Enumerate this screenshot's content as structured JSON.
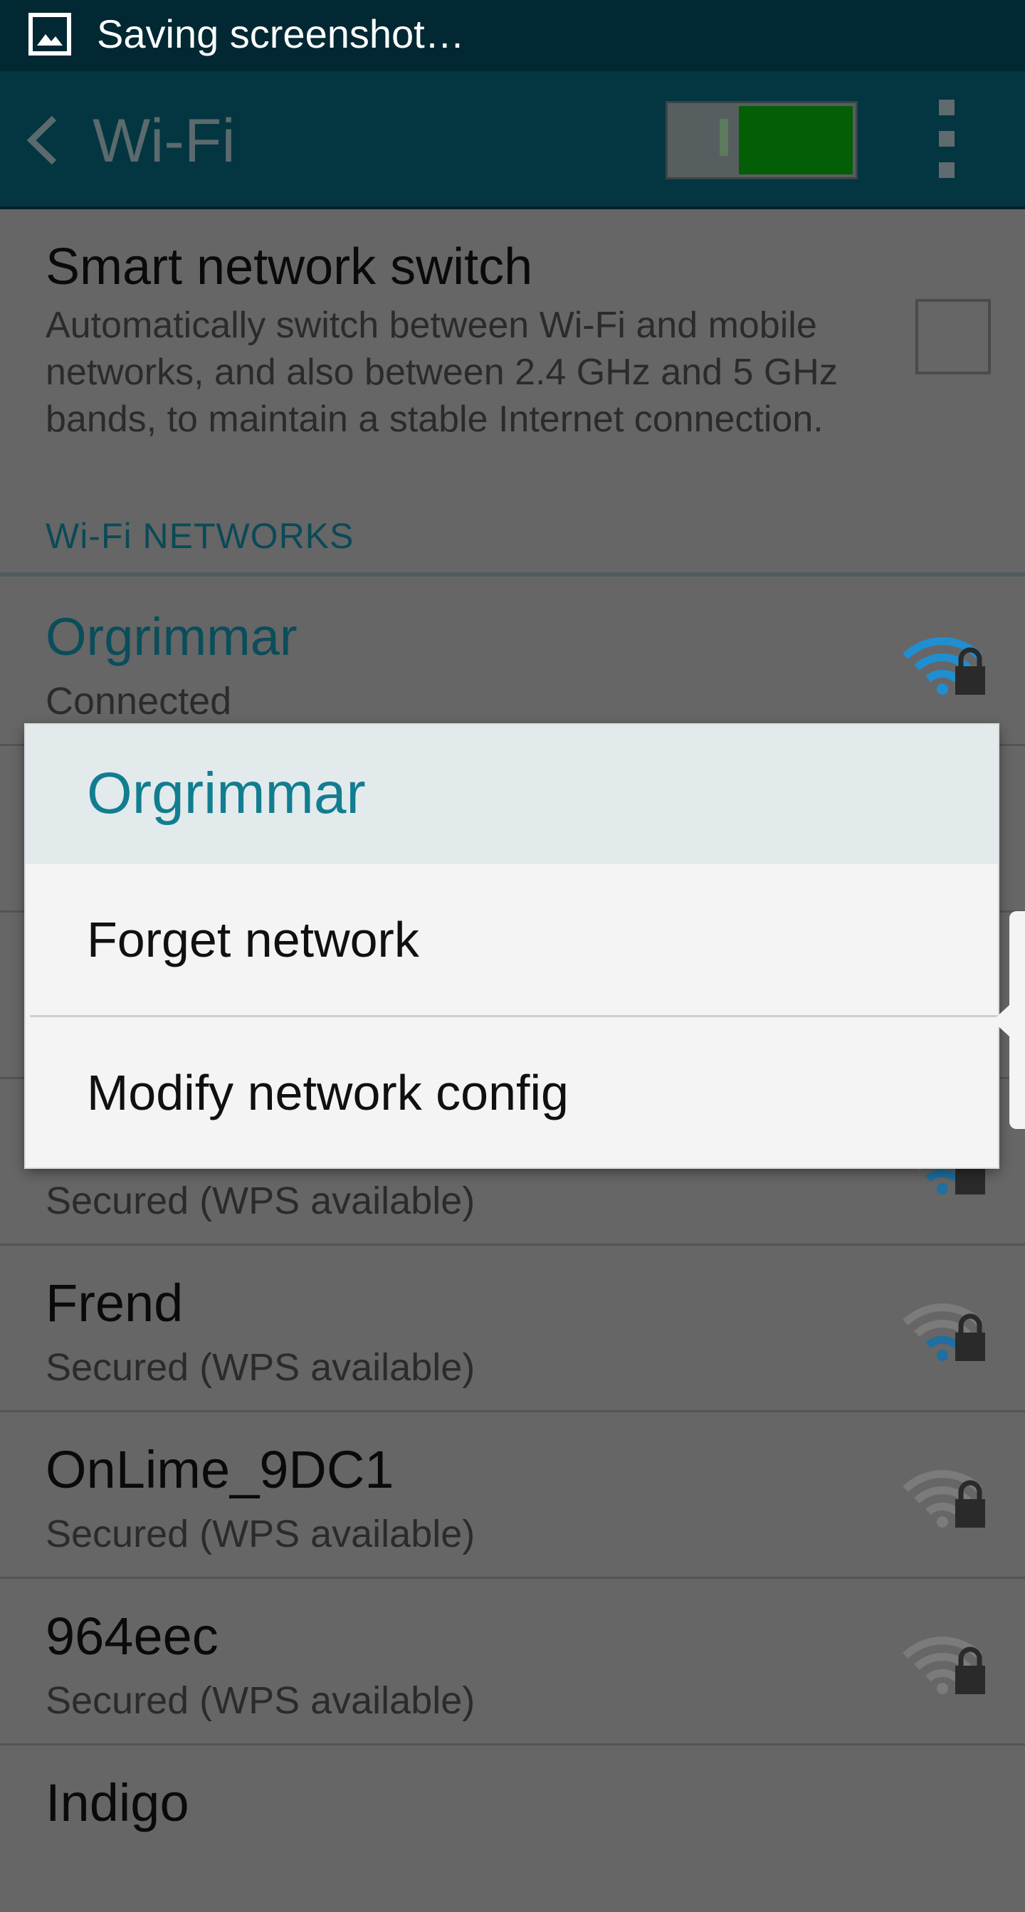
{
  "status_bar": {
    "text": "Saving screenshot…",
    "icon": "image-icon"
  },
  "app_bar": {
    "title": "Wi-Fi",
    "back_icon": "chevron-left-icon",
    "toggle_on": true,
    "menu_icon": "overflow-menu-icon"
  },
  "smart_switch": {
    "title": "Smart network switch",
    "description": "Automatically switch between Wi-Fi and mobile networks, and also between 2.4 GHz and 5 GHz bands, to maintain a stable Internet connection.",
    "checked": false
  },
  "section_title": "Wi-Fi NETWORKS",
  "networks": [
    {
      "name": "Orgrimmar",
      "status": "Connected",
      "connected": true,
      "icon": "wifi-lock-icon"
    },
    {
      "name": "",
      "status": "",
      "connected": false,
      "icon": "wifi-lock-icon"
    },
    {
      "name": "",
      "status": "",
      "connected": false,
      "icon": "wifi-lock-icon"
    },
    {
      "name": "",
      "status": "Secured (WPS available)",
      "connected": false,
      "icon": "wifi-lock-icon"
    },
    {
      "name": "Frend",
      "status": "Secured (WPS available)",
      "connected": false,
      "icon": "wifi-lock-icon"
    },
    {
      "name": "OnLime_9DC1",
      "status": "Secured (WPS available)",
      "connected": false,
      "icon": "wifi-lock-icon"
    },
    {
      "name": "964eec",
      "status": "Secured (WPS available)",
      "connected": false,
      "icon": "wifi-lock-icon"
    },
    {
      "name": "Indigo",
      "status": "",
      "connected": false,
      "icon": "wifi-lock-icon"
    }
  ],
  "dialog": {
    "title": "Orgrimmar",
    "options": [
      "Forget network",
      "Modify network config"
    ]
  },
  "colors": {
    "accent": "#127d90",
    "status_bar": "#022833",
    "app_bar": "#033640",
    "toggle_on": "#045e06",
    "wifi_connected": "#1f8fd1"
  }
}
